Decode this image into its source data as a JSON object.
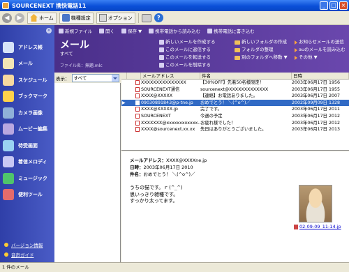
{
  "app": {
    "title": "SOURCENEXT 携快電話11"
  },
  "toolbar": {
    "home": "ホーム",
    "device": "機種設定",
    "options": "オプション"
  },
  "sidebar": {
    "items": [
      {
        "label": "アドレス帳",
        "icon": "address-book-icon",
        "color": "#d7e3f8"
      },
      {
        "label": "メール",
        "icon": "mail-icon",
        "color": "#f3e6b5"
      },
      {
        "label": "スケジュール",
        "icon": "schedule-icon",
        "color": "#f7d9a0"
      },
      {
        "label": "ブックマーク",
        "icon": "bookmark-icon",
        "color": "#ffd24a"
      },
      {
        "label": "カメラ画像",
        "icon": "camera-icon",
        "color": "#8fb0d8"
      },
      {
        "label": "ムービー編集",
        "icon": "movie-icon",
        "color": "#b9a7e0"
      },
      {
        "label": "待受画面",
        "icon": "wallpaper-icon",
        "color": "#9ad2f2"
      },
      {
        "label": "着信メロディ",
        "icon": "melody-icon",
        "color": "#c8c8f4"
      },
      {
        "label": "ミュージック",
        "icon": "music-icon",
        "color": "#4fc46b"
      },
      {
        "label": "便利ツール",
        "icon": "tools-icon",
        "color": "#e56b6b"
      }
    ],
    "version": "バージョン情報",
    "guide": "音声ガイド"
  },
  "header": {
    "actions": [
      "新規ファイル",
      "開く",
      "保存 ▼",
      "携帯電話から読み込む",
      "携帯電話に書き込む"
    ],
    "title": "メール",
    "subtitle": "すべて",
    "filename": "ファイル名：無題.mlc",
    "col1": [
      "新しいメールを作成する",
      "このメールに返信する",
      "このメールを転送する",
      "このメールを削除する"
    ],
    "col2": [
      "新しいフォルダの作成",
      "フォルダの整理",
      "別のフォルダへ移動 ▼"
    ],
    "col3": [
      "お知らせメールの送信",
      "auのメールを読み込む",
      "その他 ▼"
    ]
  },
  "folder": {
    "label": "表示：",
    "selected": "すべて"
  },
  "list": {
    "columns": [
      "メールアドレス",
      "件名",
      "日時"
    ],
    "rows": [
      {
        "addr": "XXXXXXXXXXXXXXX",
        "subject": "【30%OFF】先着50名様限定！",
        "date": "2003年06月17日 1956",
        "selected": false
      },
      {
        "addr": "SOURCENEXT通信",
        "subject": "sourcenext@XXXXXXXXXXXXX",
        "date": "2003年06月17日 1955",
        "selected": false
      },
      {
        "addr": "XXXX@XXXXX",
        "subject": "【連絡】お電話ありました。",
        "date": "2003年06月17日 2007",
        "selected": false
      },
      {
        "addr": "09030891843@p-tne.jp",
        "subject": "おめでとう！ ＼(^o^)／",
        "date": "2002年09月09日 1328",
        "selected": true
      },
      {
        "addr": "XXXX@XXXXX.jp",
        "subject": "完了です。",
        "date": "2003年06月17日 2011",
        "selected": false
      },
      {
        "addr": "SOURCENEXT",
        "subject": "今週の予定",
        "date": "2003年06月17日 2012",
        "selected": false
      },
      {
        "addr": "XXXXXXX@xxxxxxxxxxxx..",
        "subject": "お疲れ様でした！",
        "date": "2003年06月17日 2012",
        "selected": false
      },
      {
        "addr": "XXXX@sourcenext.xx.xx",
        "subject": "先日はありがとうございました。",
        "date": "2003年06月17日 2013",
        "selected": false
      }
    ]
  },
  "preview": {
    "addr_label": "メールアドレス：",
    "addr": "XXXX@XXXXne.jp",
    "date_label": "日時：",
    "date": "2003年06月17日 2010",
    "subject_label": "件名：",
    "subject": "おめでとう！ ＼(^o^)／",
    "body": "うちの猫です。ｒ(^_^)\n思いっきり雑種です。\nすっかり太ってます。",
    "attachment": "02-09-09_11-14.jp"
  },
  "status": {
    "text": "1 件のメール"
  }
}
